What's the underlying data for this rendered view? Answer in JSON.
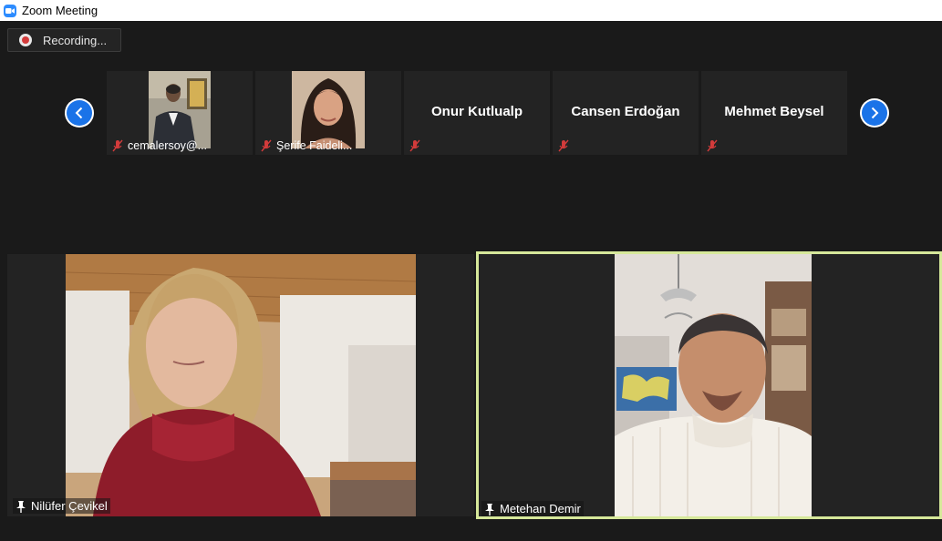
{
  "window": {
    "title": "Zoom Meeting"
  },
  "recording": {
    "label": "Recording..."
  },
  "colors": {
    "accent": "#1a73e8",
    "active_speaker": "#d6e89a",
    "mute": "#d33b3b"
  },
  "strip": [
    {
      "name": "cemalersoy@...",
      "has_video": true,
      "muted": true
    },
    {
      "name": "Şerife Faideli...",
      "has_video": true,
      "muted": true
    },
    {
      "name": "Onur Kutlualp",
      "has_video": false,
      "muted": true
    },
    {
      "name": "Cansen Erdoğan",
      "has_video": false,
      "muted": true
    },
    {
      "name": "Mehmet Beysel",
      "has_video": false,
      "muted": true
    }
  ],
  "gallery": [
    {
      "name": "Nilüfer Çevikel",
      "pinned": true,
      "active": false
    },
    {
      "name": "Metehan Demir",
      "pinned": true,
      "active": true
    }
  ],
  "icons": [
    "zoom-camera-icon",
    "record-icon",
    "chevron-left-icon",
    "chevron-right-icon",
    "mic-muted-icon",
    "pin-icon"
  ]
}
